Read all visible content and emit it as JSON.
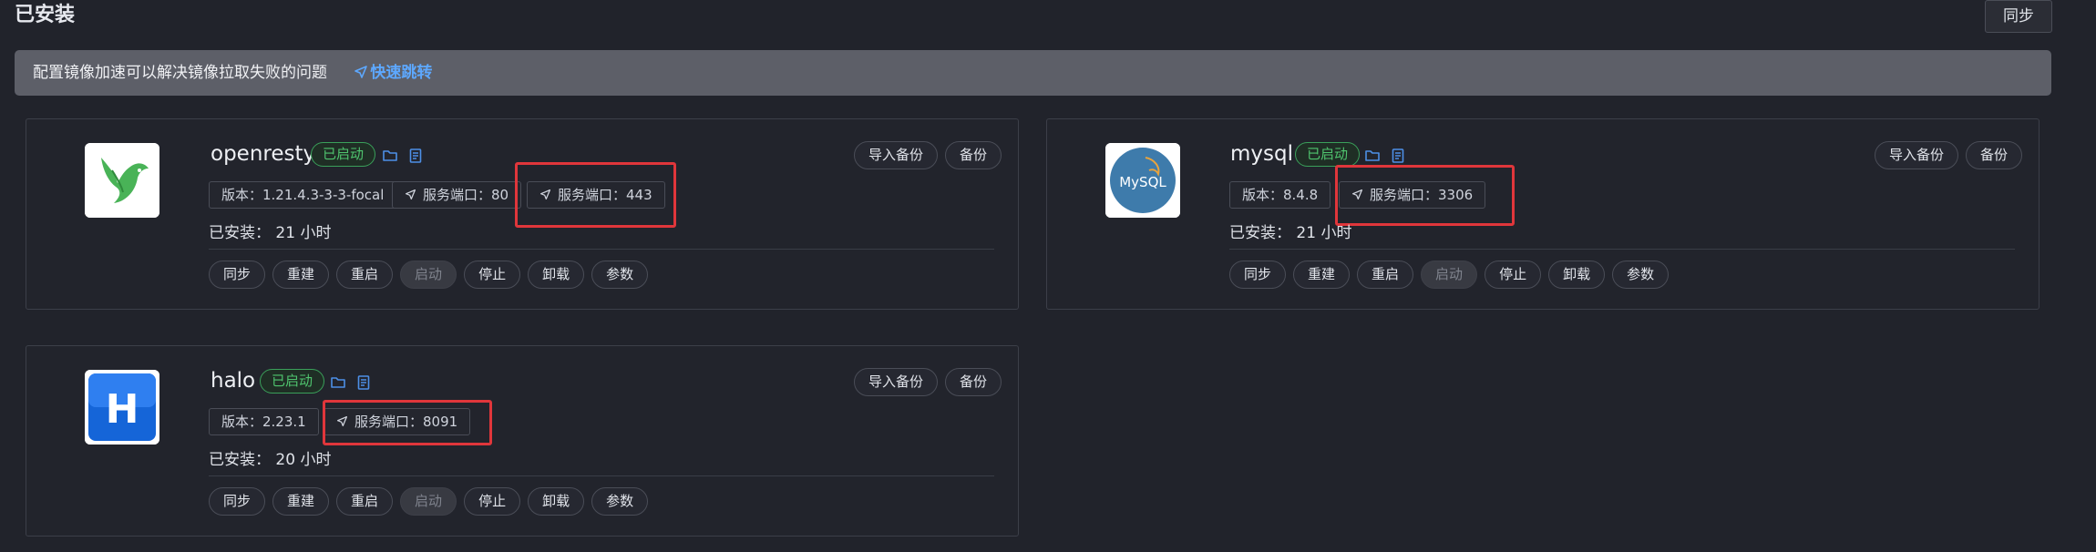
{
  "page": {
    "title": "已安装",
    "sync_label": "同步"
  },
  "notice": {
    "text": "配置镜像加速可以解决镜像拉取失败的问题",
    "link": "快速跳转"
  },
  "apps": [
    {
      "name": "openresty",
      "status": "已启动",
      "version": "版本：1.21.4.3-3-3-focal",
      "ports": [
        "服务端口：80",
        "服务端口：443"
      ],
      "installed_label": "已安装：",
      "installed_time": "21 小时"
    },
    {
      "name": "mysql",
      "status": "已启动",
      "version": "版本：8.4.8",
      "ports": [
        "服务端口：3306"
      ],
      "installed_label": "已安装：",
      "installed_time": "21 小时"
    },
    {
      "name": "halo",
      "status": "已启动",
      "version": "版本：2.23.1",
      "ports": [
        "服务端口：8091"
      ],
      "installed_label": "已安装：",
      "installed_time": "20 小时"
    }
  ],
  "card_buttons": {
    "import_backup": "导入备份",
    "backup": "备份"
  },
  "actions": {
    "sync": "同步",
    "rebuild": "重建",
    "restart": "重启",
    "start": "启动",
    "stop": "停止",
    "uninstall": "卸载",
    "params": "参数"
  },
  "logos": {
    "mysql_text": "MySQL",
    "halo_text": "H"
  },
  "colors": {
    "running_green": "#4fc46e",
    "link_blue": "#5da8ff",
    "highlight_red": "#e0363b"
  }
}
